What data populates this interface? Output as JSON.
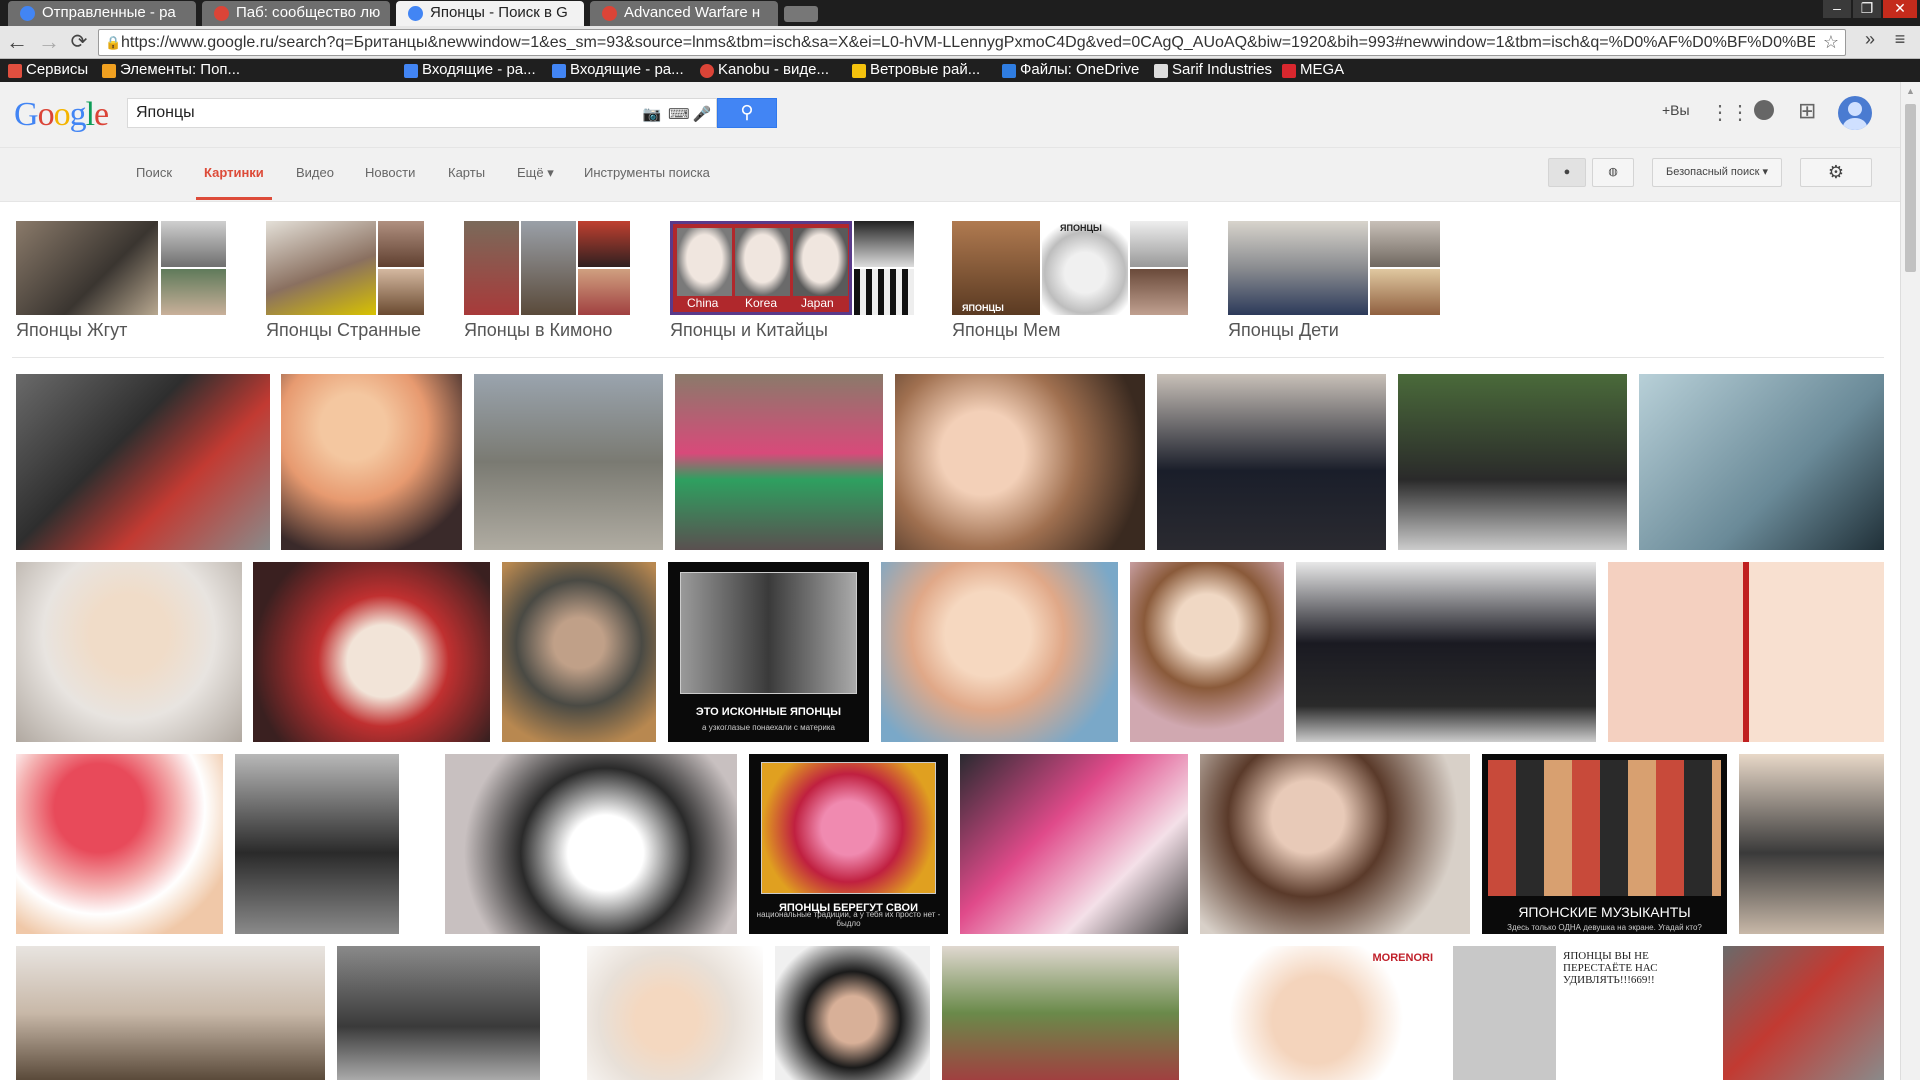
{
  "browser": {
    "tabs": [
      {
        "title": "Отправленные - ра",
        "color": "#4285f4"
      },
      {
        "title": "Паб: сообщество лю",
        "color": "#db4437"
      },
      {
        "title": "Японцы - Поиск в G",
        "color": "#4285f4"
      },
      {
        "title": "Advanced Warfare н",
        "color": "#db4437"
      }
    ],
    "window_controls": [
      "–",
      "❐",
      "✕"
    ],
    "url": "https://www.google.ru/search?q=Британцы&newwindow=1&es_sm=93&source=lnms&tbm=isch&sa=X&ei=L0-hVM-LLennygPxmoC4Dg&ved=0CAgQ_AUoAQ&biw=1920&bih=993#newwindow=1&tbm=isch&q=%D0%AF%D0%BF%D0%BE%",
    "bookmarks": [
      {
        "label": "Сервисы",
        "color": "#e04f3f"
      },
      {
        "label": "Элементы: Поп...",
        "color": "#f0a020"
      },
      {
        "label": "Входящие - ра...",
        "color": "#4285f4"
      },
      {
        "label": "Входящие - ра...",
        "color": "#4285f4"
      },
      {
        "label": "Kanobu - виде...",
        "color": "#db4437"
      },
      {
        "label": "Ветровые рай...",
        "color": "#f4c20d"
      },
      {
        "label": "Файлы: OneDrive",
        "color": "#2f7de1"
      },
      {
        "label": "Sarif Industries",
        "color": "#dddddd"
      },
      {
        "label": "MEGA",
        "color": "#d9272e"
      }
    ]
  },
  "google": {
    "logo": [
      "G",
      "o",
      "o",
      "g",
      "l",
      "e"
    ],
    "query": "Японцы",
    "plus_you": "+Вы",
    "nav": [
      "Поиск",
      "Картинки",
      "Видео",
      "Новости",
      "Карты",
      "Ещё ▾",
      "Инструменты поиска"
    ],
    "safe_search": "Безопасный поиск ▾"
  },
  "related": [
    {
      "label": "Японцы Жгут"
    },
    {
      "label": "Японцы Странные"
    },
    {
      "label": "Японцы в Кимоно"
    },
    {
      "label": "Японцы и Китайцы",
      "tags": [
        "China",
        "Korea",
        "Japan"
      ]
    },
    {
      "label": "Японцы Мем",
      "tags": [
        "ЯПОНЦЫ"
      ]
    },
    {
      "label": "Японцы Дети"
    }
  ],
  "grid_text": {
    "ainu_caption": "ЭТО ИСКОННЫЕ ЯПОНЦЫ",
    "ainu_sub": "а узкоглазые понаехали с материка",
    "kid_caption": "ЯПОНЦЫ БЕРЕГУТ СВОИ",
    "kid_sub": "национальные традиции, а у тебя их просто нет - быдло",
    "music_caption": "ЯПОНСКИЕ МУЗЫКАНТЫ",
    "music_sub": "Здесь только ОДНА девушка на экране. Угадай кто?",
    "moremori": "MORENORI",
    "meme_top": "ЯПОНЦЫ ВЫ НЕ ПЕРЕСТАЁТЕ НАС УДИВЛЯТЬ!!!669!!"
  }
}
